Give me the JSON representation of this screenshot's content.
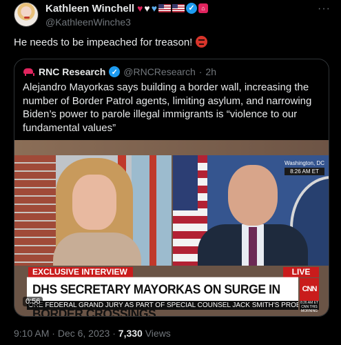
{
  "author": {
    "display_name": "Kathleen Winchell",
    "handle": "@KathleenWinche3",
    "badges": [
      "red-heart-icon",
      "white-heart-icon",
      "blue-heart-icon",
      "us-flag-icon",
      "us-flag-icon",
      "verified-icon",
      "red-house-icon"
    ]
  },
  "tweet": {
    "text": "He needs to be impeached for treason!",
    "emoji": "angry-face-icon"
  },
  "quote": {
    "name": "RNC Research",
    "handle": "@RNCResearch",
    "separator": "·",
    "time": "2h",
    "text": "Alejandro Mayorkas says building a border wall, increasing the number of Border Patrol agents, limiting asylum, and narrowing Biden’s power to parole illegal immigrants is “violence to our fundamental values”"
  },
  "video": {
    "location": "Washington, DC",
    "clock": "8:26 AM ET",
    "exclusive_label": "EXCLUSIVE INTERVIEW",
    "live_label": "LIVE",
    "headline": "DHS SECRETARY MAYORKAS ON SURGE IN BORDER CROSSINGS",
    "network": "CNN",
    "ticker": "ORE FEDERAL GRAND JURY AS PART OF SPECIAL COUNSEL JACK SMITH'S PROBE AND H",
    "ticker_clock": "8:26 AM ET",
    "show": "CNN THIS MORNING",
    "timestamp": "0:56"
  },
  "footer": {
    "time": "9:10 AM",
    "date": "Dec 6, 2023",
    "views_count": "7,330",
    "views_label": "Views"
  },
  "colors": {
    "background": "#000000",
    "text": "#e7e9ea",
    "secondary_text": "#71767b",
    "verified": "#1d9bf0",
    "cnn_red": "#c91c1c"
  }
}
